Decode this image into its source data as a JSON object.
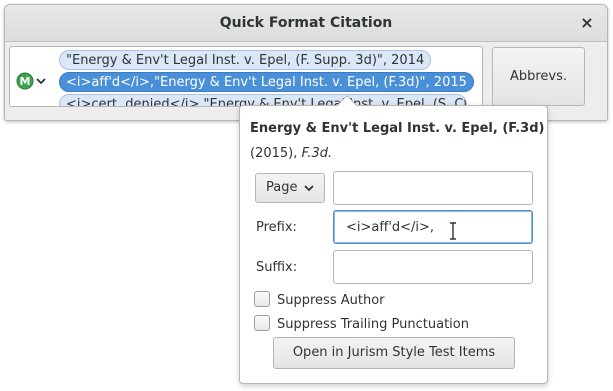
{
  "window": {
    "title": "Quick Format Citation",
    "close_glyph": "×"
  },
  "style_selector": {
    "icon": "mendeley-m-icon",
    "badge_letter": "M",
    "badge_color": "#3fa34d"
  },
  "citations": [
    {
      "text": "\"Energy & Env't Legal Inst. v. Epel, (F. Supp. 3d)\", 2014",
      "selected": false
    },
    {
      "text": "<i>aff'd</i>,\"Energy & Env't Legal Inst. v. Epel, (F.3d)\", 2015",
      "selected": true
    },
    {
      "text": "<i>cert. denied</i>,\"Energy & Env't Legal Inst. v. Epel, (S. Ct.)\"",
      "selected": false
    }
  ],
  "abbrevs_button": {
    "label": "Abbrevs."
  },
  "panel": {
    "title": "Energy & Env't Legal Inst. v. Epel, (F.3d)",
    "subtitle_year": "(2015),",
    "subtitle_reporter": "F.3d.",
    "locator_select": {
      "selected": "Page"
    },
    "locator_value": "",
    "prefix_label": "Prefix:",
    "prefix_value": "<i>aff'd</i>,",
    "suffix_label": "Suffix:",
    "suffix_value": "",
    "suppress_author": {
      "label": "Suppress Author",
      "checked": false
    },
    "suppress_punct": {
      "label": "Suppress Trailing Punctuation",
      "checked": false
    },
    "open_button": "Open in Jurism Style Test Items"
  },
  "colors": {
    "accent": "#4a90d9",
    "bubble_bg": "#dbe6f6"
  }
}
